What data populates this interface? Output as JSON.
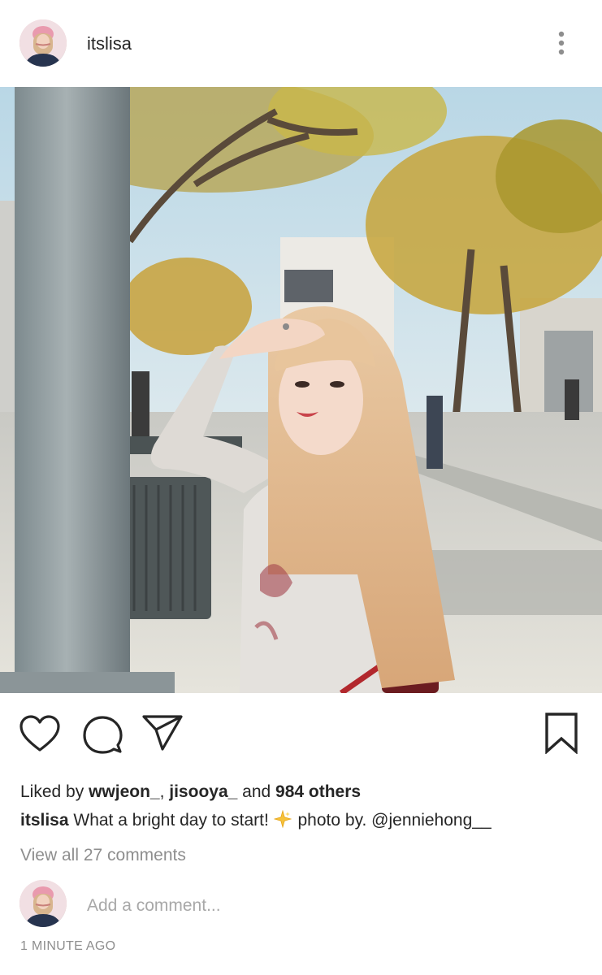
{
  "post": {
    "username": "itslisa",
    "avatar_icon": "profile-avatar",
    "more_icon": "more-vertical-icon"
  },
  "photo": {
    "description_icon": "post-photo"
  },
  "actions": {
    "like_icon": "heart-icon",
    "comment_icon": "comment-bubble-icon",
    "share_icon": "paper-plane-icon",
    "save_icon": "bookmark-icon"
  },
  "likes": {
    "prefix": "Liked by ",
    "user1": "wwjeon_",
    "separator": ", ",
    "user2": "jisooya_",
    "and_text": " and ",
    "others": "984 others"
  },
  "caption": {
    "username": "itslisa",
    "text_before": " What a bright day to start! ",
    "emoji": "sparkle-star-emoji",
    "text_after": " photo by. @jenniehong__"
  },
  "comments": {
    "view_all": "View all 27 comments",
    "add_placeholder": "Add a comment..."
  },
  "timestamp": "1 MINUTE AGO",
  "colors": {
    "text": "#262626",
    "muted": "#8e8e8e",
    "placeholder": "#a8a8a8",
    "background": "#ffffff"
  }
}
